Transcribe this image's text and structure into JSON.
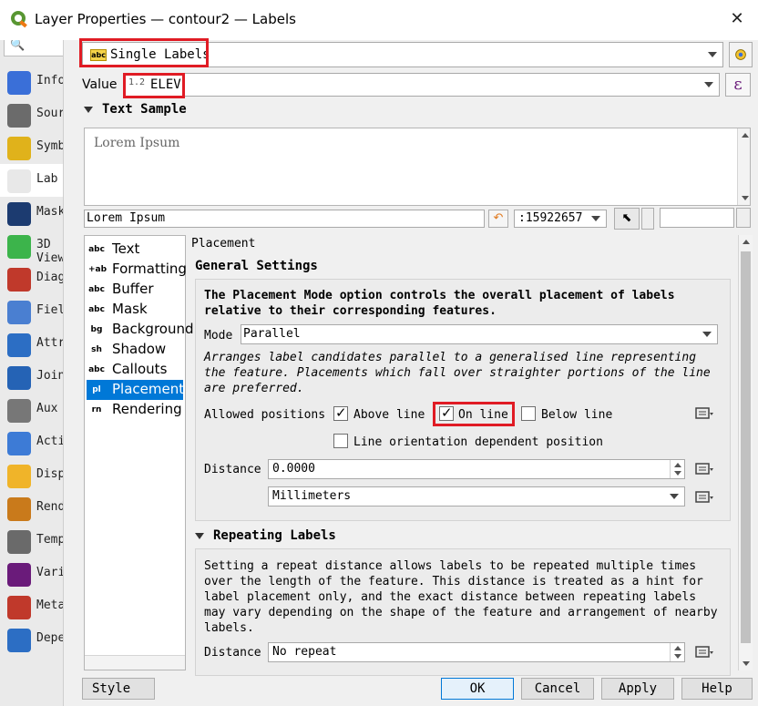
{
  "window": {
    "title": "Layer Properties — contour2 — Labels",
    "close": "✕"
  },
  "nav": {
    "items": [
      {
        "label": "Information",
        "icon": "info-icon"
      },
      {
        "label": "Source",
        "icon": "source-icon"
      },
      {
        "label": "Symbology",
        "icon": "symbology-icon"
      },
      {
        "label": "Labels",
        "icon": "labels-icon"
      },
      {
        "label": "Masks",
        "icon": "masks-icon"
      },
      {
        "label": "3D View",
        "icon": "3d-view-icon"
      },
      {
        "label": "Diagrams",
        "icon": "diagrams-icon"
      },
      {
        "label": "Fields",
        "icon": "fields-icon"
      },
      {
        "label": "Attributes Form",
        "icon": "attributes-icon"
      },
      {
        "label": "Joins",
        "icon": "joins-icon"
      },
      {
        "label": "Auxiliary Storage",
        "icon": "auxiliary-icon"
      },
      {
        "label": "Actions",
        "icon": "actions-icon"
      },
      {
        "label": "Display",
        "icon": "display-icon"
      },
      {
        "label": "Rendering",
        "icon": "rendering-icon"
      },
      {
        "label": "Temporal",
        "icon": "temporal-icon"
      },
      {
        "label": "Variables",
        "icon": "variables-icon"
      },
      {
        "label": "Metadata",
        "icon": "metadata-icon"
      },
      {
        "label": "Dependencies",
        "icon": "dependencies-icon"
      }
    ],
    "short": [
      "Info",
      "Sour",
      "Symb",
      "Lab",
      "Mask",
      "3D",
      "Diag",
      "Fiel",
      "Attr",
      "Join",
      "Aux",
      "Acti",
      "Disp",
      "Rend",
      "Temp",
      "Vari",
      "Meta",
      "Depe"
    ],
    "short2": {
      "3D": "View"
    }
  },
  "label_mode": {
    "value": "Single Labels",
    "badge": "abc"
  },
  "value_field": {
    "label": "Value",
    "type_badge": "1.2",
    "value": "ELEV"
  },
  "text_sample": {
    "header": "Text Sample",
    "preview": "Lorem Ipsum",
    "input": "Lorem Ipsum",
    "scale": ":15922657"
  },
  "tabs": [
    {
      "label": "Text",
      "icon": "abc"
    },
    {
      "label": "Formatting",
      "icon": "+ab"
    },
    {
      "label": "Buffer",
      "icon": "abc"
    },
    {
      "label": "Mask",
      "icon": "abc"
    },
    {
      "label": "Background",
      "icon": "bg"
    },
    {
      "label": "Shadow",
      "icon": "sh"
    },
    {
      "label": "Callouts",
      "icon": "abc"
    },
    {
      "label": "Placement",
      "icon": "pl"
    },
    {
      "label": "Rendering",
      "icon": "rn"
    }
  ],
  "placement": {
    "title": "Placement",
    "general_header": "General Settings",
    "intro": "The Placement Mode option controls the overall placement of labels relative to their corresponding features.",
    "mode_label": "Mode",
    "mode_value": "Parallel",
    "mode_desc": "Arranges label candidates parallel to a generalised line representing the feature. Placements which fall over straighter portions of the line are preferred.",
    "allowed_label": "Allowed positions",
    "above_line": "Above line",
    "on_line": "On line",
    "below_line": "Below line",
    "orientation": "Line orientation dependent position",
    "distance_label": "Distance",
    "distance_value": "0.0000",
    "distance_unit": "Millimeters"
  },
  "repeating": {
    "header": "Repeating Labels",
    "desc": "Setting a repeat distance allows labels to be repeated multiple times over the length of the feature. This distance is treated as a hint for label placement only, and the exact distance between repeating labels may vary depending on the shape of the feature and arrangement of nearby labels.",
    "distance_label": "Distance",
    "distance_value": "No repeat"
  },
  "footer": {
    "style": "Style",
    "ok": "OK",
    "cancel": "Cancel",
    "apply": "Apply",
    "help": "Help"
  },
  "colors": {
    "highlight": "#e01b24",
    "selection": "#0078d7"
  }
}
